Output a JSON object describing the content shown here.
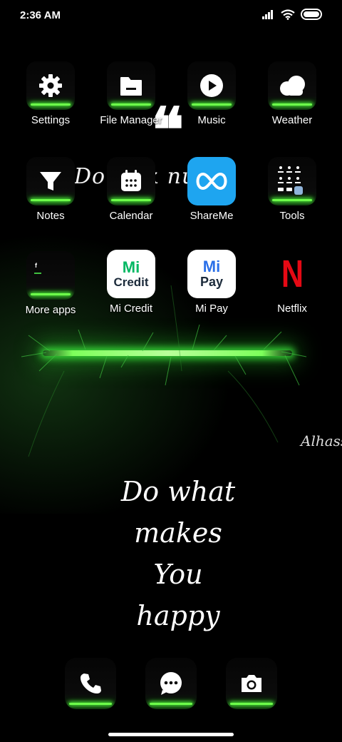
{
  "status_bar": {
    "time": "2:36 AM"
  },
  "apps": {
    "row1": [
      {
        "label": "Settings",
        "icon": "gear-icon"
      },
      {
        "label": "File Manager",
        "icon": "folder-icon"
      },
      {
        "label": "Music",
        "icon": "play-icon"
      },
      {
        "label": "Weather",
        "icon": "cloud-icon"
      }
    ],
    "row2": [
      {
        "label": "Notes",
        "icon": "funnel-icon"
      },
      {
        "label": "Calendar",
        "icon": "calendar-icon"
      },
      {
        "label": "ShareMe",
        "icon": "infinity-icon"
      },
      {
        "label": "Tools",
        "icon": "tools-folder-icon"
      }
    ],
    "row3": [
      {
        "label": "More apps",
        "icon": "folder-icon"
      },
      {
        "label": "Mi Credit",
        "icon": "mi-credit-logo",
        "logo_top": "Mi",
        "logo_bottom": "Credit"
      },
      {
        "label": "Mi Pay",
        "icon": "mi-pay-logo",
        "logo_top": "Mi",
        "logo_bottom": "Pay"
      },
      {
        "label": "Netflix",
        "icon": "netflix-logo",
        "logo": "N"
      }
    ]
  },
  "wallpaper": {
    "quote_open": "❝",
    "partial_text": "Dor   ink   nuc",
    "signature": "Alhass",
    "quote_lines": [
      "Do what",
      "makes",
      "You",
      "happy"
    ]
  },
  "dock": [
    {
      "icon": "phone-icon"
    },
    {
      "icon": "message-icon"
    },
    {
      "icon": "camera-icon"
    }
  ],
  "colors": {
    "accent_green": "#6dff4a",
    "shareme_blue": "#1ea5f0",
    "mi_green": "#00b863",
    "mi_blue": "#2a6fe8",
    "netflix_red": "#e50914"
  }
}
